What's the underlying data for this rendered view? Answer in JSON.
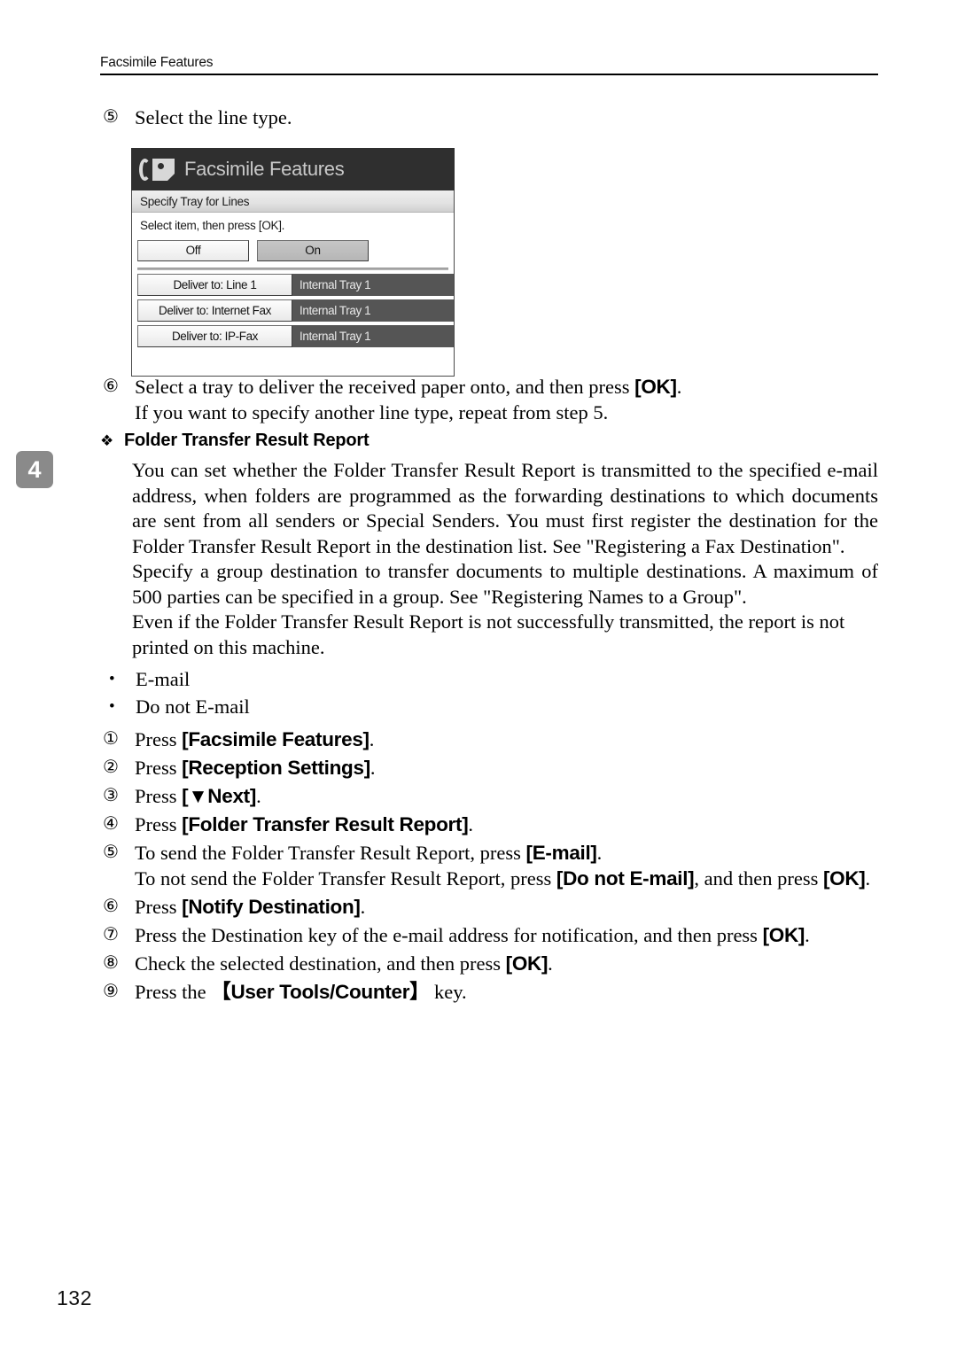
{
  "running_header": {
    "title": "Facsimile Features"
  },
  "page_number": "132",
  "chapter_tab": {
    "number": "4"
  },
  "step5_intro": {
    "marker": "⑤",
    "text": "Select the line type."
  },
  "lcd_panel": {
    "title": "Facsimile Features",
    "icon_name": "fax-document-icon",
    "subheader": "Specify Tray for Lines",
    "instruction": "Select item, then press [OK].",
    "toggle": {
      "off_label": "Off",
      "on_label": "On",
      "selected": "On"
    },
    "rows": [
      {
        "key": "Deliver to: Line 1",
        "value": "Internal Tray 1"
      },
      {
        "key": "Deliver to: Internet Fax",
        "value": "Internal Tray 1"
      },
      {
        "key": "Deliver to: IP-Fax",
        "value": "Internal Tray 1"
      }
    ],
    "colors": {
      "titlebar": "#2f2f2f",
      "value_field": "#555555",
      "selected_button": "#c6c6c6"
    }
  },
  "step6": {
    "marker": "⑥",
    "line1_a": "Select a tray to deliver the received paper onto, and then press ",
    "line1_key": "[OK]",
    "line1_b": ".",
    "line2": "If you want to specify another line type, repeat from step 5."
  },
  "section": {
    "diamond": "❖",
    "heading": "Folder Transfer Result Report",
    "paragraphs": [
      "You can set whether the Folder Transfer Result Report is transmitted to the specified e-mail address, when folders are programmed as the forwarding destinations to which documents are sent from all senders or Special Senders. You must first register the destination for the Folder Transfer Result Report in the destination list. See \"Registering a Fax Destination\".",
      "Specify a group destination to transfer documents to multiple destinations. A maximum of 500 parties can be specified in a group. See \"Registering Names to a Group\".",
      "Even if the Folder Transfer Result Report is not successfully transmitted, the report is not printed on this machine."
    ],
    "options": [
      {
        "bullet": "•",
        "label": "E-mail"
      },
      {
        "bullet": "•",
        "label": "Do not E-mail"
      }
    ]
  },
  "steps": [
    {
      "marker": "①",
      "prefix": "Press ",
      "key": "[Facsimile Features]",
      "suffix": "."
    },
    {
      "marker": "②",
      "prefix": "Press ",
      "key": "[Reception Settings]",
      "suffix": "."
    },
    {
      "marker": "③",
      "prefix": "Press ",
      "key": "[▼Next]",
      "suffix": "."
    },
    {
      "marker": "④",
      "prefix": "Press ",
      "key": "[Folder Transfer Result Report]",
      "suffix": "."
    },
    {
      "marker": "⑤",
      "line1_prefix": "To send the Folder Transfer Result Report, press ",
      "line1_key": "[E-mail]",
      "line1_suffix": ".",
      "line2_prefix": "To not send the Folder Transfer Result Report, press ",
      "line2_key": "[Do not E-mail]",
      "line2_mid": ", and then press ",
      "line2_key2": "[OK]",
      "line2_suffix": "."
    },
    {
      "marker": "⑥",
      "prefix": "Press ",
      "key": "[Notify Destination]",
      "suffix": "."
    },
    {
      "marker": "⑦",
      "line1": "Press the Destination key of the e-mail address for notification, and then press ",
      "key": "[OK]",
      "suffix": "."
    },
    {
      "marker": "⑧",
      "prefix": "Check the selected destination, and then press ",
      "key": "[OK]",
      "suffix": "."
    },
    {
      "marker": "⑨",
      "prefix": "Press the ",
      "key": "【User Tools/Counter】",
      "suffix": " key."
    }
  ]
}
